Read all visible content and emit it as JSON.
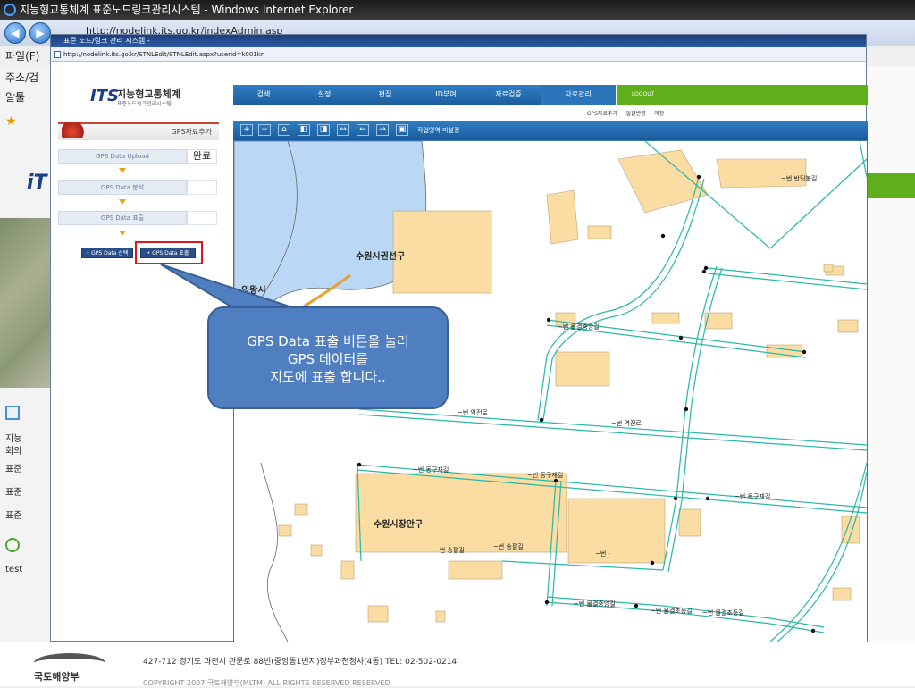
{
  "outer_window": {
    "title": "지능형교통체계 표준노드링크관리시스템 - Windows Internet Explorer",
    "url": "http://nodelink.its.go.kr/indexAdmin.asp",
    "menu_file": "파일(F)",
    "side_rows": [
      "주소/검",
      "알툴"
    ],
    "side_notice_items": [
      "지능",
      "회의",
      "표준",
      "표준",
      "표준",
      "test"
    ],
    "footer_address": "427-712 경기도 과천시 관문로 88번(중앙동1번지)정부과천청사(4동)  TEL: 02-502-0214",
    "footer_copyright": "COPYRIGHT  2007 국토해양부(MLTM) ALL RIGHTS RESERVED   RESERVED",
    "footer_org": "국토해양부"
  },
  "inner_window": {
    "title": "표준 노드/링크 관리 시스템 -",
    "url": "http://nodelink.its.go.kr/STNLEdit/STNLEdit.aspx?userid=k001kr"
  },
  "logo": {
    "mark": "ITS",
    "title": "지능형교통체계",
    "subtitle": "표준노드링크관리시스템"
  },
  "gps_panel": {
    "header": "GPS자료추가",
    "steps": [
      {
        "label": "GPS Data Upload",
        "status": "완료"
      },
      {
        "label": "GPS Data 분석",
        "status": ""
      },
      {
        "label": "GPS Data 표출",
        "status": ""
      }
    ],
    "btn_select": "• GPS Data 선택",
    "btn_show": "• GPS Data 표출"
  },
  "top_nav": {
    "items": [
      "검색",
      "설정",
      "편집",
      "ID부여",
      "자료검증",
      "자료관리"
    ],
    "logout": "LOGOUT",
    "sub_items": [
      "· GPS자료추가",
      "· 일괄반영",
      "· 저장"
    ]
  },
  "map_toolbar": {
    "buttons": [
      "+",
      "−",
      "⌂",
      "◧",
      "◨",
      "↔",
      "←",
      "→",
      "▣"
    ],
    "status": "작업영역 미설정"
  },
  "map": {
    "labels": {
      "district1": "수원시권선구",
      "city": "의왕시",
      "district2": "수원시장안구",
      "r1": "~번 반딧불길",
      "r2": "~번 물결중앙길",
      "r3": "~번 역전로",
      "r4": "~번 역전로",
      "r5": "~번 동구재길",
      "r6": "~번 동구재길",
      "r7": "~번 동구재길",
      "r8": "~번 송팔길",
      "r9": "~번 송팔길",
      "r10": "~번 물결중앙길",
      "r11": "~번 물결초등길",
      "r12": "~번 물결초등길",
      "r13": "~번 -"
    }
  },
  "callout": {
    "lines": [
      "GPS Data 표출 버튼을 눌러",
      "GPS 데이터를",
      "지도에 표출 합니다.."
    ]
  },
  "colors": {
    "nav_blue": "#1d5d9e",
    "green": "#5fae1c",
    "building": "#fbdca2",
    "water": "#bad8f5",
    "road": "#27b8a8",
    "highlight": "#e0151b",
    "callout": "#4f7fc0"
  }
}
